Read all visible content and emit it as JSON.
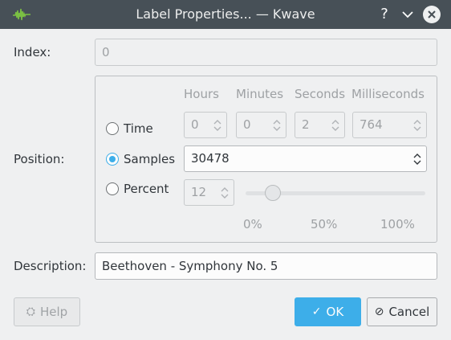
{
  "window": {
    "title": "Label Properties... — Kwave",
    "help_glyph": "?",
    "icon": "kwave-waveform-icon"
  },
  "form": {
    "index_label": "Index:",
    "index_value": "0",
    "position_label": "Position:",
    "description_label": "Description:",
    "description_value": "Beethoven - Symphony No. 5"
  },
  "columns": {
    "hours": "Hours",
    "minutes": "Minutes",
    "seconds": "Seconds",
    "milliseconds": "Milliseconds"
  },
  "mode": {
    "time_label": "Time",
    "samples_label": "Samples",
    "percent_label": "Percent",
    "selected": "samples"
  },
  "time_values": {
    "hours": "0",
    "minutes": "0",
    "seconds": "2",
    "milliseconds": "764"
  },
  "samples_value": "30478",
  "percent": {
    "value": "12",
    "slider_fraction": 0.12,
    "ticks": [
      "0%",
      "50%",
      "100%"
    ]
  },
  "buttons": {
    "help": "Help",
    "ok": "OK",
    "cancel": "Cancel"
  },
  "colors": {
    "accent": "#3daee9",
    "titlebar": "#475057"
  }
}
